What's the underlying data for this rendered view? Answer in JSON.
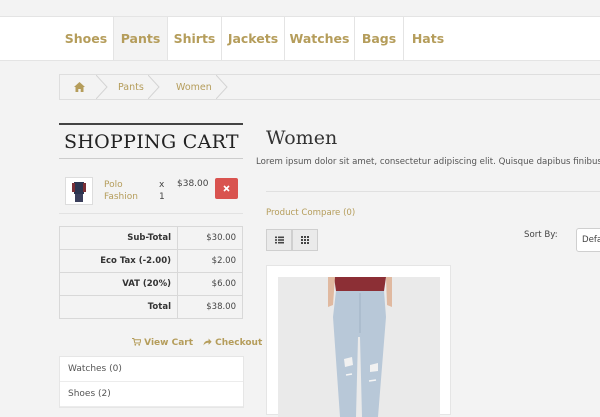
{
  "menu": {
    "items": [
      {
        "label": "Shoes",
        "active": false
      },
      {
        "label": "Pants",
        "active": true
      },
      {
        "label": "Shirts",
        "active": false
      },
      {
        "label": "Jackets",
        "active": false
      },
      {
        "label": "Watches",
        "active": false
      },
      {
        "label": "Bags",
        "active": false
      },
      {
        "label": "Hats",
        "active": false
      }
    ]
  },
  "breadcrumb": {
    "home_icon": "home-icon",
    "items": [
      "Pants",
      "Women"
    ]
  },
  "cart": {
    "title": "SHOPPING CART",
    "item": {
      "name": "Polo Fashion",
      "qty_prefix": "x",
      "qty": "1",
      "price": "$38.00",
      "remove_icon": "close-icon"
    },
    "totals": [
      {
        "label": "Sub-Total",
        "value": "$30.00"
      },
      {
        "label": "Eco Tax (-2.00)",
        "value": "$2.00"
      },
      {
        "label": "VAT (20%)",
        "value": "$6.00"
      },
      {
        "label": "Total",
        "value": "$38.00"
      }
    ],
    "view_cart": "View Cart",
    "checkout": "Checkout"
  },
  "categories": [
    {
      "label": "Watches (0)"
    },
    {
      "label": "Shoes (2)"
    }
  ],
  "main": {
    "title": "Women",
    "description": "Lorem ipsum dolor sit amet, consectetur adipiscing elit. Quisque dapibus finibus facilisis",
    "compare": "Product Compare (0)",
    "sort_label": "Sort By:",
    "sort_value": "Default"
  },
  "colors": {
    "accent": "#b59d5b",
    "danger": "#d9534f"
  }
}
